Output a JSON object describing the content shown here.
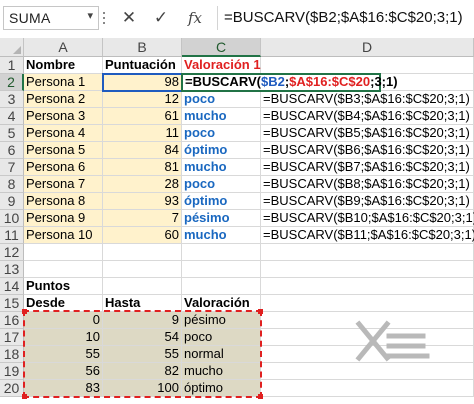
{
  "formula_bar": {
    "name_box": "SUMA",
    "cancel_icon": "✕",
    "enter_icon": "✓",
    "function_icon": "fx",
    "formula": "=BUSCARV($B2;$A$16:$C$20;3;1)"
  },
  "columns": [
    "A",
    "B",
    "C",
    "D"
  ],
  "rows": [
    "1",
    "2",
    "3",
    "4",
    "5",
    "6",
    "7",
    "8",
    "9",
    "10",
    "11",
    "12",
    "13",
    "14",
    "15",
    "16",
    "17",
    "18",
    "19",
    "20"
  ],
  "header": {
    "a": "Nombre",
    "b": "Puntuación",
    "c": "Valoración 1"
  },
  "people": [
    {
      "name": "Persona 1",
      "score": "98",
      "rating": "",
      "formula": ""
    },
    {
      "name": "Persona 2",
      "score": "12",
      "rating": "poco",
      "formula": "=BUSCARV($B3;$A$16:$C$20;3;1)"
    },
    {
      "name": "Persona 3",
      "score": "61",
      "rating": "mucho",
      "formula": "=BUSCARV($B4;$A$16:$C$20;3;1)"
    },
    {
      "name": "Persona 4",
      "score": "11",
      "rating": "poco",
      "formula": "=BUSCARV($B5;$A$16:$C$20;3;1)"
    },
    {
      "name": "Persona 5",
      "score": "84",
      "rating": "óptimo",
      "formula": "=BUSCARV($B6;$A$16:$C$20;3;1)"
    },
    {
      "name": "Persona 6",
      "score": "81",
      "rating": "mucho",
      "formula": "=BUSCARV($B7;$A$16:$C$20;3;1)"
    },
    {
      "name": "Persona 7",
      "score": "28",
      "rating": "poco",
      "formula": "=BUSCARV($B8;$A$16:$C$20;3;1)"
    },
    {
      "name": "Persona 8",
      "score": "93",
      "rating": "óptimo",
      "formula": "=BUSCARV($B9;$A$16:$C$20;3;1)"
    },
    {
      "name": "Persona 9",
      "score": "7",
      "rating": "pésimo",
      "formula": "=BUSCARV($B10;$A$16:$C$20;3;1)"
    },
    {
      "name": "Persona 10",
      "score": "60",
      "rating": "mucho",
      "formula": "=BUSCARV($B11;$A$16:$C$20;3;1)"
    }
  ],
  "active_cell_formula": {
    "prefix": "=BUSCARV(",
    "ref1": "$B2",
    "sep1": ";",
    "ref2": "$A$16:$C$20",
    "suffix": ";3;1)"
  },
  "puntos": {
    "title": "Puntos",
    "headers": {
      "desde": "Desde",
      "hasta": "Hasta",
      "valoracion": "Valoración"
    },
    "rows": [
      {
        "desde": "0",
        "hasta": "9",
        "valoracion": "pésimo"
      },
      {
        "desde": "10",
        "hasta": "54",
        "valoracion": "poco"
      },
      {
        "desde": "55",
        "hasta": "55",
        "valoracion": "normal"
      },
      {
        "desde": "56",
        "hasta": "82",
        "valoracion": "mucho"
      },
      {
        "desde": "83",
        "hasta": "100",
        "valoracion": "óptimo"
      }
    ]
  },
  "colors": {
    "accent_green": "#217346",
    "ref_blue": "#1f5bbf",
    "ref_red": "#e02020",
    "highlight_yellow": "#fff2cc",
    "table_tan": "#ddd9c4",
    "rating_blue": "#1a68c0"
  },
  "watermark": {
    "icon": "x-logo-watermark"
  }
}
